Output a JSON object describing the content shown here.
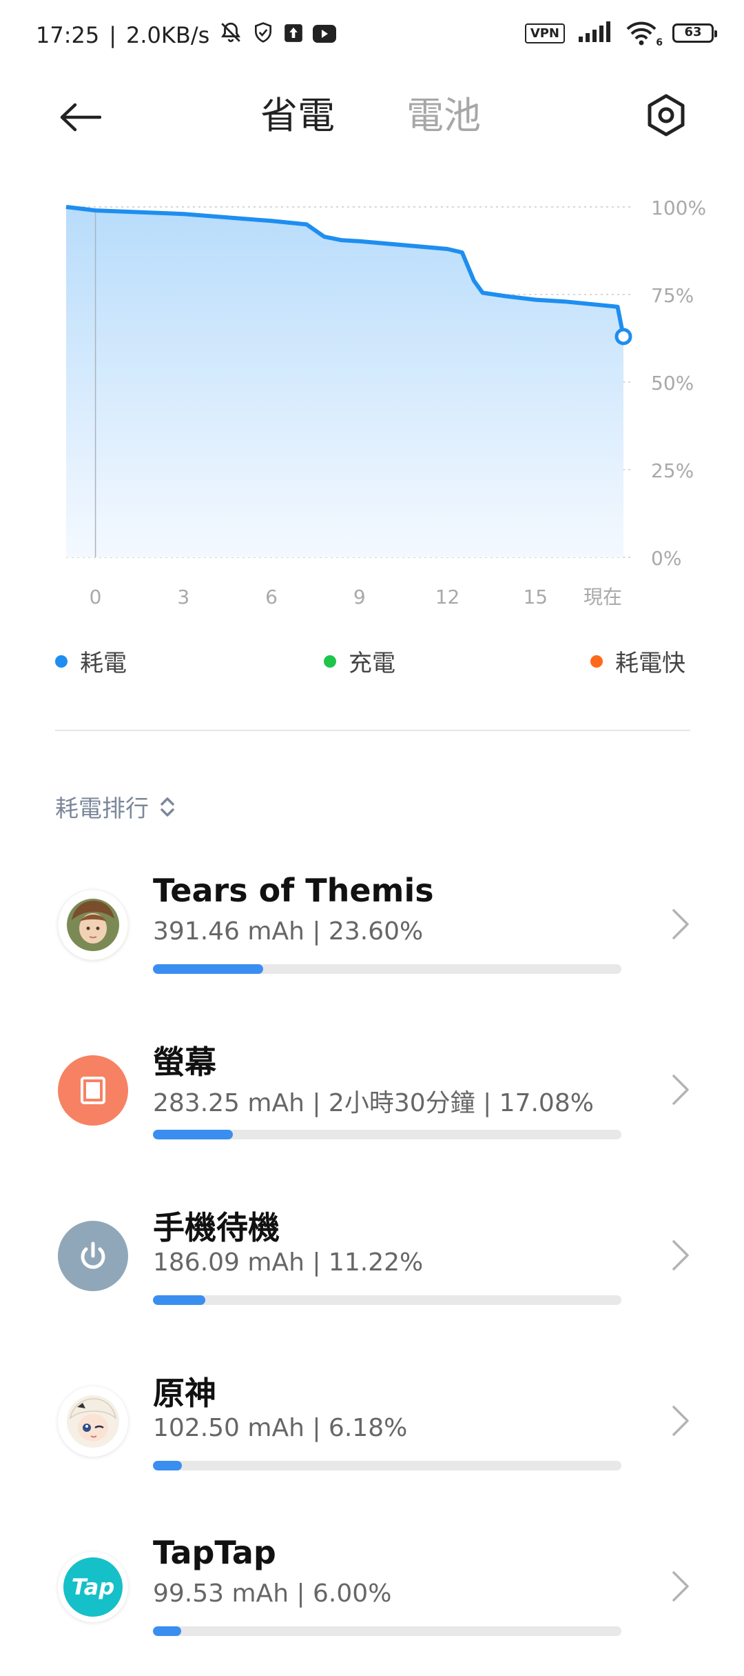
{
  "status_bar": {
    "time": "17:25",
    "network_speed": "2.0KB/s",
    "vpn_label": "VPN",
    "battery_level": "63",
    "wifi_sub": "6",
    "icons": [
      "bell-off-icon",
      "shield-icon",
      "upload-icon",
      "youtube-icon",
      "signal-icon",
      "wifi-icon",
      "battery-icon"
    ]
  },
  "header": {
    "tabs": [
      {
        "label": "省電",
        "active": true
      },
      {
        "label": "電池",
        "active": false
      }
    ]
  },
  "chart_data": {
    "type": "area",
    "x_tick_labels": [
      "0",
      "3",
      "6",
      "9",
      "12",
      "15",
      "現在"
    ],
    "y_tick_labels": [
      "100%",
      "75%",
      "50%",
      "25%",
      "0%"
    ],
    "ylim": [
      0,
      100
    ],
    "xlim": [
      -1,
      18
    ],
    "grid": true,
    "color": "#1e8ef0",
    "points": [
      [
        -1,
        100
      ],
      [
        0,
        99
      ],
      [
        3,
        98
      ],
      [
        6,
        96
      ],
      [
        7.2,
        95
      ],
      [
        7.8,
        91.5
      ],
      [
        8.4,
        90.5
      ],
      [
        9,
        90.2
      ],
      [
        12,
        88
      ],
      [
        12.5,
        87
      ],
      [
        12.9,
        79
      ],
      [
        13.2,
        75.5
      ],
      [
        14,
        74.5
      ],
      [
        15,
        73.5
      ],
      [
        16,
        73
      ],
      [
        17.8,
        71.5
      ],
      [
        18,
        63
      ]
    ]
  },
  "legend": [
    {
      "label": "耗電",
      "color": "#1e8ef0"
    },
    {
      "label": "充電",
      "color": "#1fc44b"
    },
    {
      "label": "耗電快",
      "color": "#ff6a1a"
    }
  ],
  "sort": {
    "label": "耗電排行"
  },
  "apps": [
    {
      "name": "Tears of Themis",
      "detail": "391.46 mAh | 23.60%",
      "fraction": 0.236,
      "icon": "game-avatar-icon",
      "icon_bg": "#b79a6e"
    },
    {
      "name": "螢幕",
      "detail": "283.25 mAh | 2小時30分鐘 | 17.08%",
      "fraction": 0.1708,
      "icon": "screen-icon",
      "icon_bg": "#f68263"
    },
    {
      "name": "手機待機",
      "detail": "186.09 mAh | 11.22%",
      "fraction": 0.1122,
      "icon": "power-icon",
      "icon_bg": "#8fa7b9"
    },
    {
      "name": "原神",
      "detail": "102.50 mAh | 6.18%",
      "fraction": 0.0618,
      "icon": "game-character-icon",
      "icon_bg": "#f3eee6"
    },
    {
      "name": "TapTap",
      "detail": "99.53 mAh | 6.00%",
      "fraction": 0.06,
      "icon": "taptap-icon",
      "icon_bg": "#16c0c8",
      "icon_text": "Tap"
    }
  ]
}
